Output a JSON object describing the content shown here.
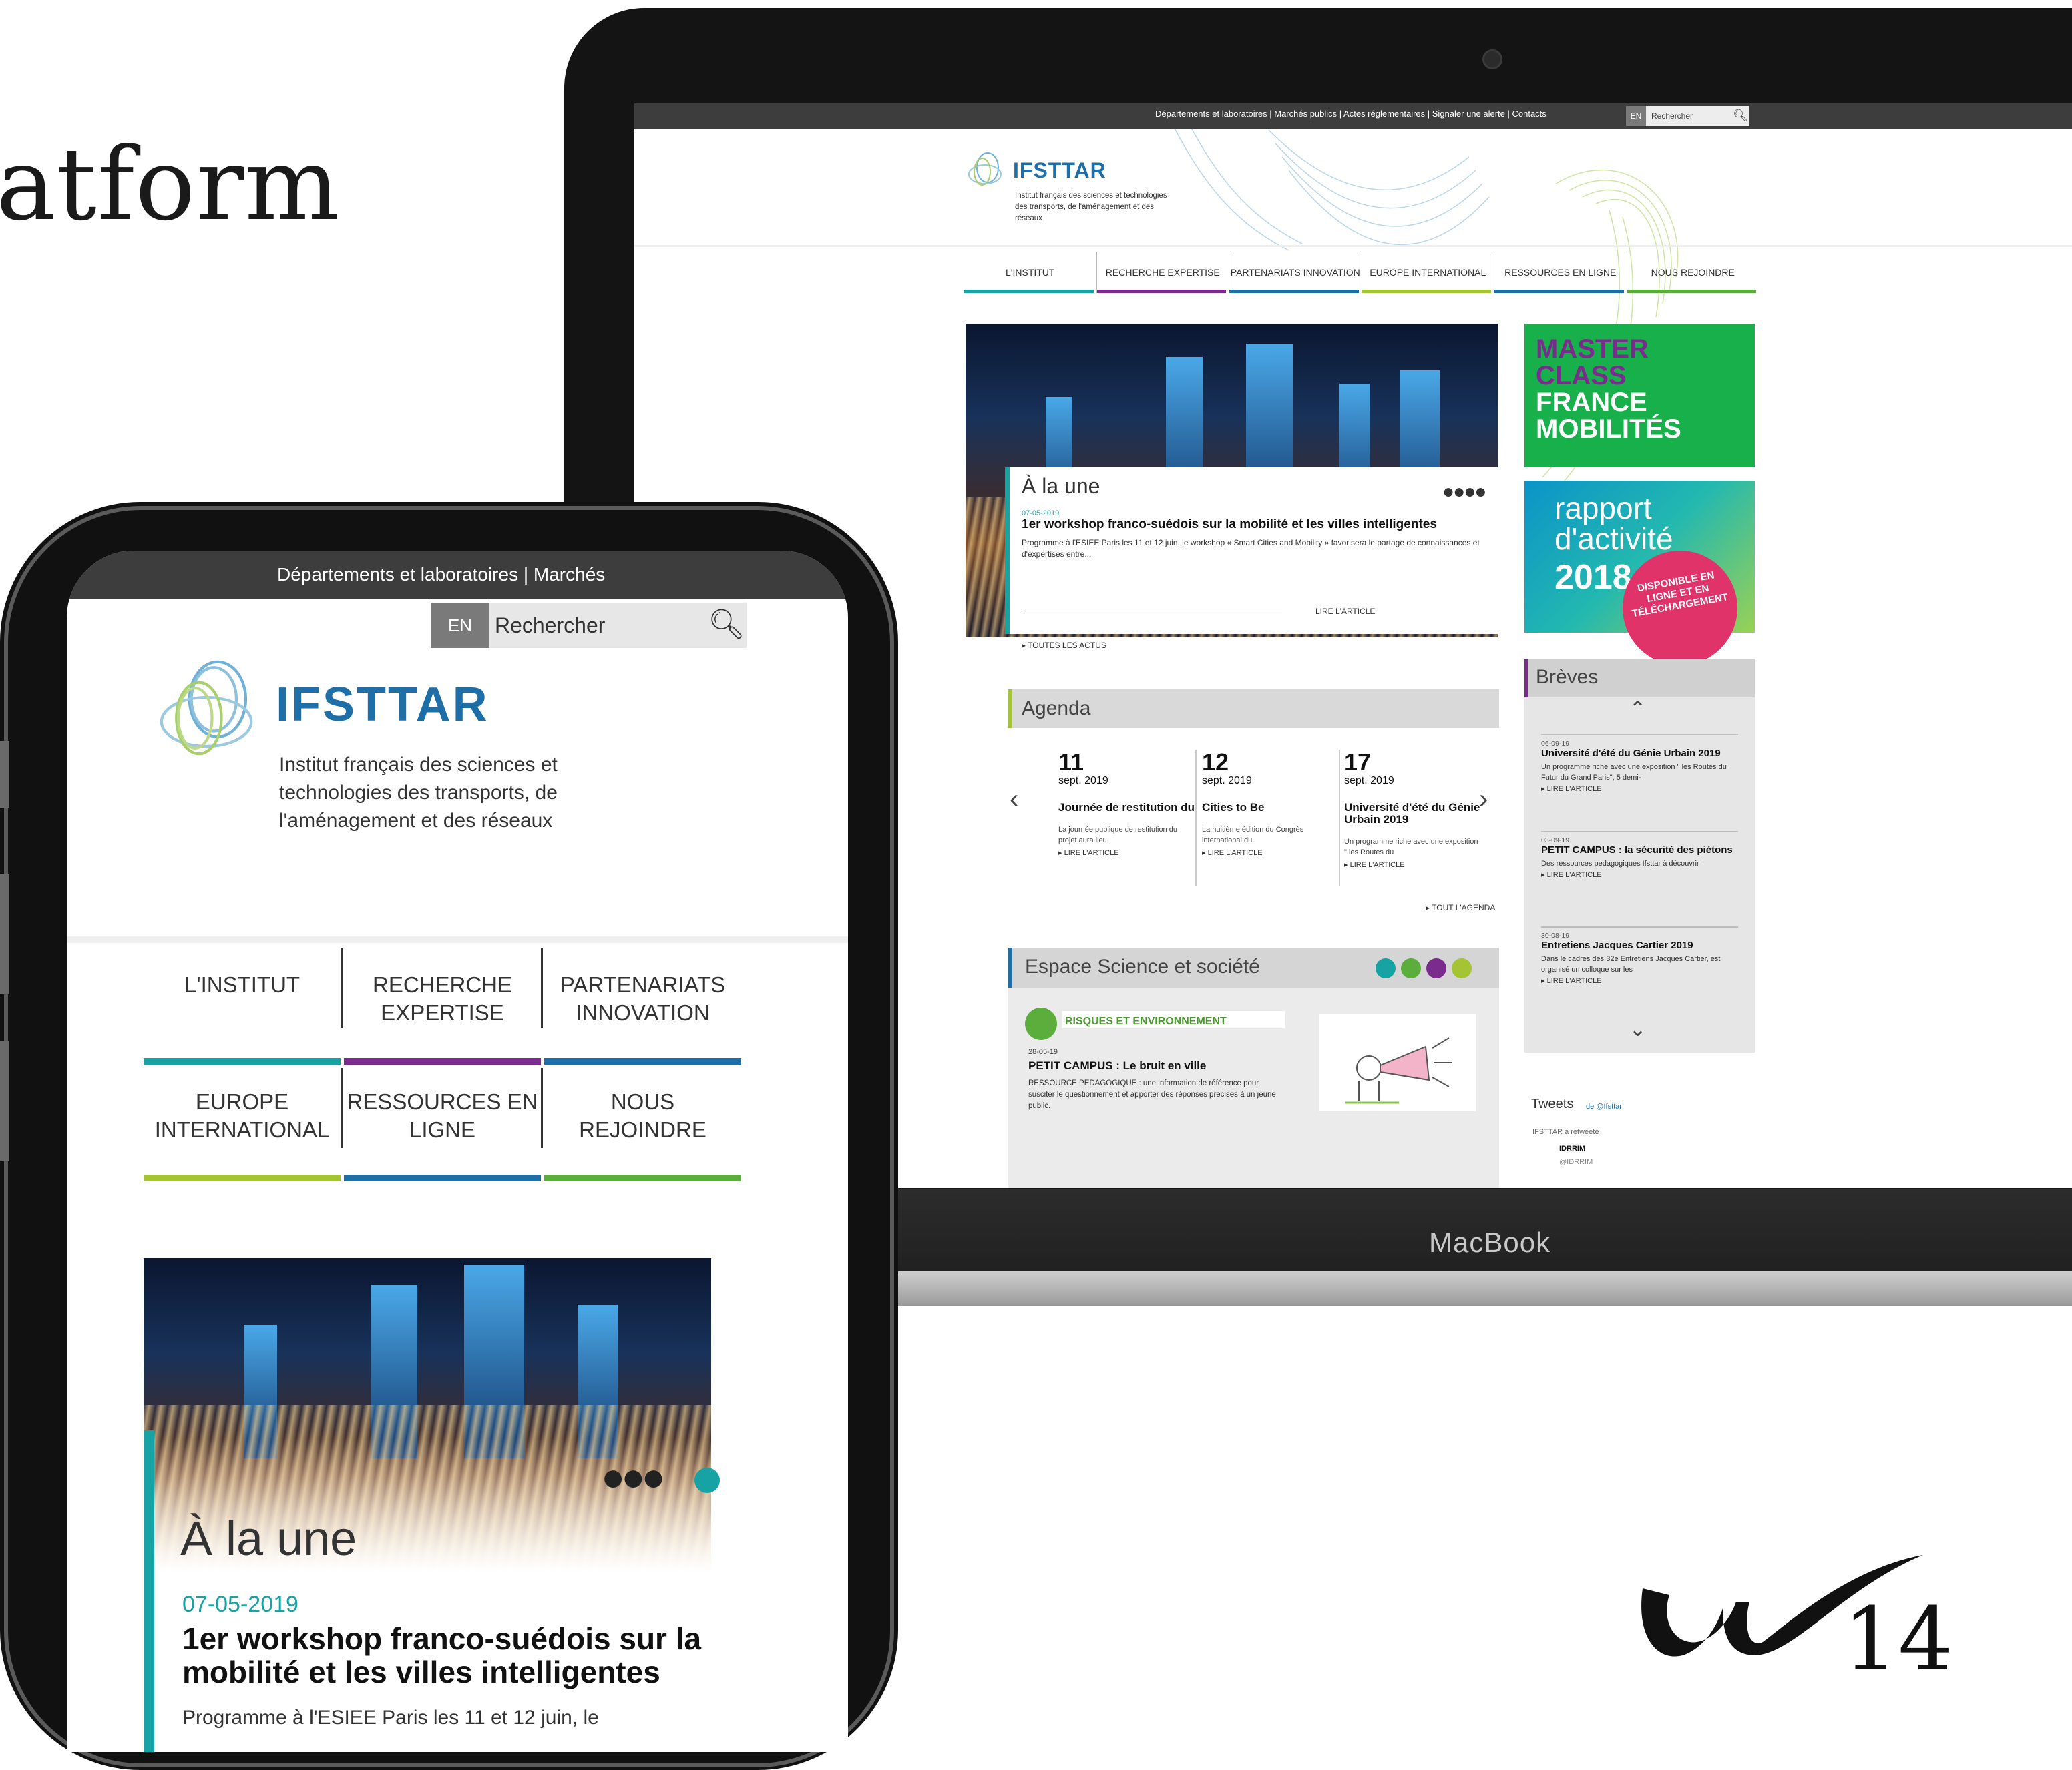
{
  "slide": {
    "title": "atform",
    "page_number": "14"
  },
  "laptop": {
    "brand": "MacBook",
    "site": {
      "top_menu": "Départements et laboratoires | Marchés publics | Actes réglementaires | Signaler une alerte | Contacts",
      "lang": "EN",
      "search_placeholder": "Rechercher",
      "logo_text": "IFSTTAR",
      "logo_sub": "Institut français des sciences et technologies des transports, de l'aménagement et des réseaux",
      "nav": [
        {
          "label": "L'INSTITUT",
          "color": "#17a3a3"
        },
        {
          "label": "RECHERCHE EXPERTISE",
          "color": "#7b2b8e"
        },
        {
          "label": "PARTENARIATS INNOVATION",
          "color": "#1e6fa8"
        },
        {
          "label": "EUROPE INTERNATIONAL",
          "color": "#a5c433"
        },
        {
          "label": "RESSOURCES EN LIGNE",
          "color": "#1e6fa8"
        },
        {
          "label": "NOUS REJOINDRE",
          "color": "#5cae3c"
        }
      ],
      "hero": {
        "section": "À la une",
        "dots": "●●●●",
        "date": "07-05-2019",
        "headline": "1er workshop franco-suédois sur la mobilité et les villes intelligentes",
        "teaser": "Programme à l'ESIEE Paris les 11 et 12 juin, le workshop « Smart Cities and Mobility » favorisera le partage de connaissances et d'expertises entre...",
        "read_more": "LIRE L'ARTICLE",
        "all_news": "▸ TOUTES LES ACTUS"
      },
      "agenda": {
        "title": "Agenda",
        "items": [
          {
            "day": "11",
            "month": "sept. 2019",
            "title": "Journée de restitution du",
            "summary": "La journée publique de restitution du projet aura lieu",
            "read": "▸ LIRE L'ARTICLE"
          },
          {
            "day": "12",
            "month": "sept. 2019",
            "title": "Cities to Be",
            "summary": "La huitième édition du Congrès international du",
            "read": "▸ LIRE L'ARTICLE"
          },
          {
            "day": "17",
            "month": "sept. 2019",
            "title": "Université d'été du Génie Urbain 2019",
            "summary": "Un programme riche avec une exposition \" les Routes du",
            "read": "▸ LIRE L'ARTICLE"
          }
        ],
        "all": "▸ TOUT L'AGENDA"
      },
      "science": {
        "title": "Espace Science et société",
        "tag": "RISQUES ET ENVIRONNEMENT",
        "date": "28-05-19",
        "headline": "PETIT CAMPUS : Le bruit en ville",
        "summary": "RESSOURCE PEDAGOGIQUE : une information de référence pour susciter le questionnement et apporter des réponses precises à un jeune public."
      },
      "master_class": {
        "line1": "MASTER CLASS",
        "line2": "FRANCE MOBILITÉS"
      },
      "rapport": {
        "line1": "rapport d'activité",
        "year": "2018",
        "badge": "DISPONIBLE EN LIGNE ET EN TÉLÉCHARGEMENT"
      },
      "breves": {
        "title": "Brèves",
        "items": [
          {
            "date": "06-09-19",
            "title": "Université d'été du Génie Urbain 2019",
            "summary": "Un programme riche avec une exposition \" les Routes du Futur du Grand Paris\", 5 demi-",
            "read": "▸ LIRE L'ARTICLE"
          },
          {
            "date": "03-09-19",
            "title": "PETIT CAMPUS : la sécurité des piétons",
            "summary": "Des ressources pedagogiques Ifsttar à découvrir",
            "read": "▸ LIRE L'ARTICLE"
          },
          {
            "date": "30-08-19",
            "title": "Entretiens Jacques Cartier 2019",
            "summary": "Dans le cadres des 32e Entretiens Jacques Cartier, est organisé un colloque sur les",
            "read": "▸ LIRE L'ARTICLE"
          }
        ]
      },
      "tweets": {
        "title": "Tweets",
        "by": "de @Ifsttar",
        "retweet": "IFSTTAR a retweeté",
        "user": "IDRRIM",
        "handle": "@IDRRIM"
      }
    }
  },
  "phone": {
    "top_menu": "Départements et laboratoires | Marchés",
    "lang": "EN",
    "search_placeholder": "Rechercher",
    "logo_text": "IFSTTAR",
    "logo_sub": "Institut français des sciences et technologies des transports, de l'aménagement et des réseaux",
    "nav": [
      {
        "label": "L'INSTITUT",
        "color": "#17a3a3"
      },
      {
        "label": "RECHERCHE EXPERTISE",
        "color": "#7b2b8e"
      },
      {
        "label": "PARTENARIATS INNOVATION",
        "color": "#1e6fa8"
      },
      {
        "label": "EUROPE INTERNATIONAL",
        "color": "#a5c433"
      },
      {
        "label": "RESSOURCES EN LIGNE",
        "color": "#1e6fa8"
      },
      {
        "label": "NOUS REJOINDRE",
        "color": "#5cae3c"
      }
    ],
    "hero": {
      "section": "À la une",
      "dots": "●●●",
      "date": "07-05-2019",
      "headline": "1er workshop franco-suédois sur la mobilité et les villes intelligentes",
      "teaser": "Programme à l'ESIEE Paris les 11 et 12 juin, le"
    }
  },
  "icons": [
    "search-icon",
    "chevron-left-icon",
    "chevron-right-icon",
    "chevron-up-icon",
    "chevron-down-icon",
    "twitter-icon",
    "info-icon",
    "megaphone-illustration"
  ]
}
